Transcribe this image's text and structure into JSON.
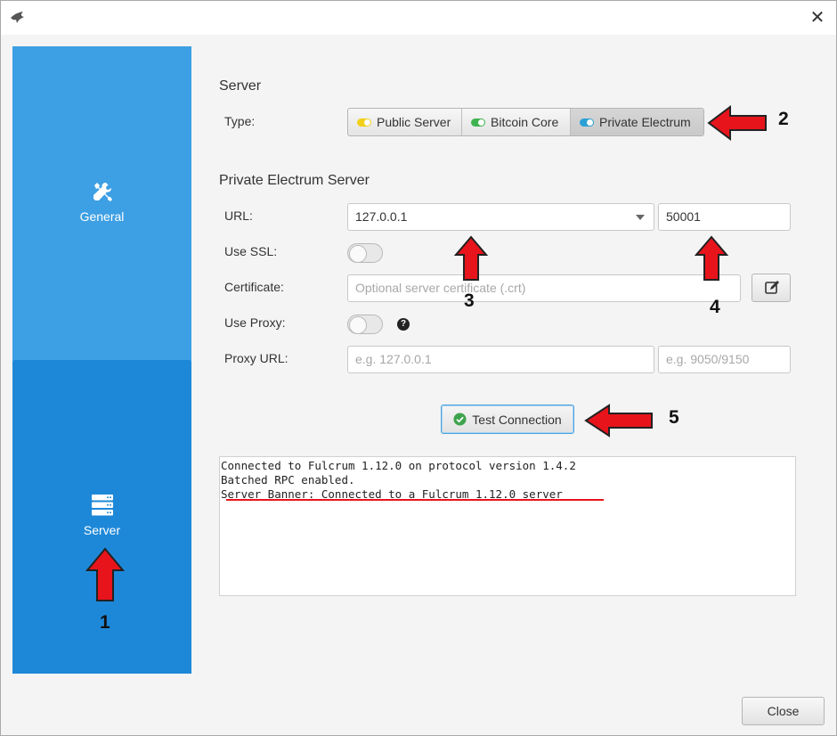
{
  "window": {
    "app_icon": "bird-logo-icon",
    "close_icon": "close-icon",
    "close_glyph": "✕"
  },
  "sidebar": {
    "items": [
      {
        "label": "General",
        "icon": "wrench-screwdriver-icon",
        "selected": false
      },
      {
        "label": "Server",
        "icon": "server-stack-icon",
        "selected": true
      }
    ],
    "colors": {
      "background": "#3d9fe4",
      "selected": "#1e88d8"
    }
  },
  "server": {
    "section_title": "Server",
    "type_label": "Type:",
    "types": [
      {
        "label": "Public Server",
        "dot_color": "#f2d01a",
        "selected": false
      },
      {
        "label": "Bitcoin Core",
        "dot_color": "#3fb34f",
        "selected": false
      },
      {
        "label": "Private Electrum",
        "dot_color": "#2aa1d6",
        "selected": true
      }
    ]
  },
  "private_electrum": {
    "section_title": "Private Electrum Server",
    "url_label": "URL:",
    "url_host": "127.0.0.1",
    "url_port": "50001",
    "use_ssl_label": "Use SSL:",
    "use_ssl": false,
    "certificate_label": "Certificate:",
    "certificate_placeholder": "Optional server certificate (.crt)",
    "use_proxy_label": "Use Proxy:",
    "use_proxy": false,
    "help_glyph": "?",
    "proxy_url_label": "Proxy URL:",
    "proxy_host_placeholder": "e.g. 127.0.0.1",
    "proxy_port_placeholder": "e.g. 9050/9150"
  },
  "test_button": {
    "label": "Test Connection",
    "icon": "check-circle-icon"
  },
  "log_lines": [
    "Connected to Fulcrum 1.12.0 on protocol version 1.4.2",
    "Batched RPC enabled.",
    "Server Banner: Connected to a Fulcrum 1.12.0 server"
  ],
  "footer": {
    "close_label": "Close"
  },
  "annotations": {
    "numbers": [
      "1",
      "2",
      "3",
      "4",
      "5"
    ],
    "arrow_color": "#e8141c"
  }
}
